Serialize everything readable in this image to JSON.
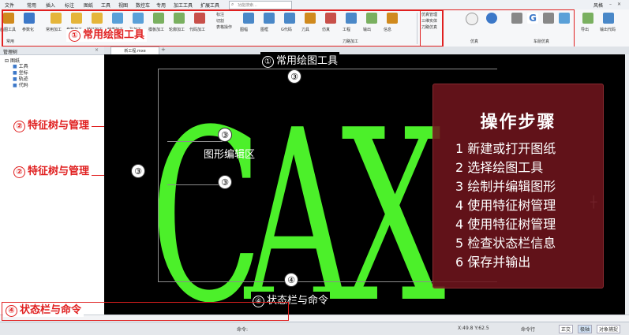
{
  "menubar": {
    "items": [
      "文件",
      "常用",
      "插入",
      "标注",
      "图纸",
      "工具",
      "视图",
      "数控车",
      "专用",
      "加工工具",
      "扩展工具"
    ],
    "search_placeholder": "功能搜索...",
    "user_label": "风格"
  },
  "ribbon": {
    "buttons": [
      "画图工具",
      "参数化",
      "常用加工",
      "参数加工",
      "特征加工",
      "轴类加工",
      "孔加工",
      "模板加工",
      "轮廓加工",
      "代码加工",
      "标注",
      "切割",
      "表格操作",
      "图幅",
      "图框",
      "G代码",
      "刀具",
      "仿真",
      "工程",
      "输出",
      "信息"
    ],
    "group_labels": [
      "常用",
      "刀路加工",
      "仿真",
      "车削仿真"
    ],
    "right_buttons": [
      "仿真管理",
      "三维实体",
      "刀路仿真",
      "快速仿真",
      "导出",
      "输出代码"
    ]
  },
  "annotations": {
    "ribbon": {
      "num": "①",
      "text": "常用绘图工具"
    },
    "tree1": {
      "num": "②",
      "text": "特征树与管理"
    },
    "tree2": {
      "num": "②",
      "text": "特征树与管理"
    },
    "canvas_top": {
      "num": "①",
      "text": "常用绘图工具"
    },
    "status_canvas": {
      "num": "④",
      "text": "状态栏与命令"
    },
    "status_left": {
      "num": "④",
      "text": "状态栏与命令"
    },
    "edit_area": "图形编辑区",
    "dim_num": "③",
    "dim_num_bottom": "④"
  },
  "tree": {
    "title": "管理树",
    "root": "图纸",
    "items": [
      "工具",
      "坐标",
      "轨迹",
      "代码"
    ]
  },
  "doc_tab": "新工程.mxe",
  "canvas": {
    "text": "CAX"
  },
  "steps": {
    "title": "操作步骤",
    "items": [
      "1 新建或打开图纸",
      "2 选择绘图工具",
      "3 绘制并编辑图形",
      "4 使用特征树管理",
      "4 使用特征树管理",
      "5 检查状态栏信息",
      "6 保存并输出"
    ]
  },
  "statusbar": {
    "left": "命令:",
    "coords": "X:49.8 Y:62.5",
    "mode": "命令行",
    "right_items": [
      "正交",
      "极轴",
      "对象捕捉"
    ]
  }
}
